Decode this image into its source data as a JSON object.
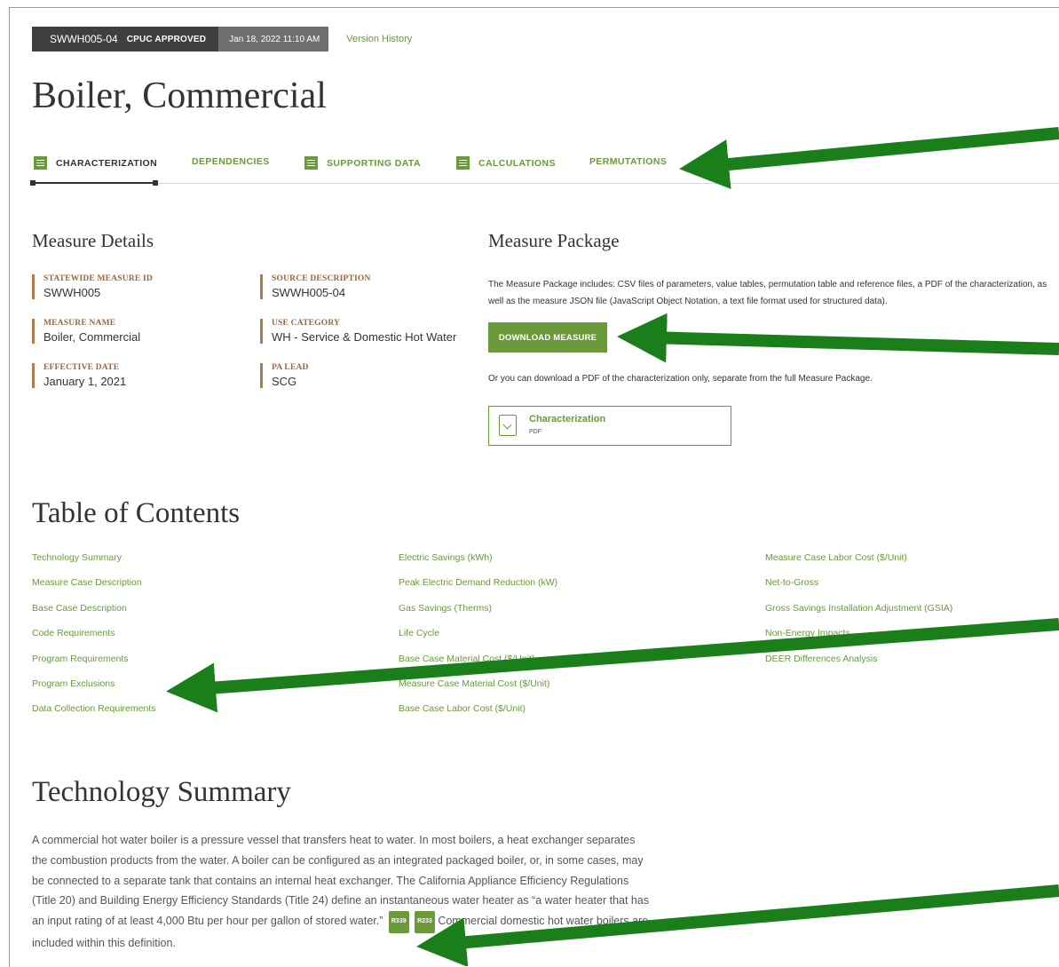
{
  "header": {
    "measure_code": "SWWH005-04",
    "status": "CPUC APPROVED",
    "timestamp": "Jan 18, 2022 11:10 AM",
    "version_history": "Version History"
  },
  "title": "Boiler, Commercial",
  "tabs": [
    {
      "label": "CHARACTERIZATION",
      "icon": "document-icon"
    },
    {
      "label": "DEPENDENCIES"
    },
    {
      "label": "SUPPORTING DATA",
      "icon": "document-icon"
    },
    {
      "label": "CALCULATIONS",
      "icon": "document-icon"
    },
    {
      "label": "PERMUTATIONS"
    }
  ],
  "measure_details": {
    "heading": "Measure Details",
    "fields": [
      {
        "label": "STATEWIDE MEASURE ID",
        "value": "SWWH005"
      },
      {
        "label": "SOURCE DESCRIPTION",
        "value": "SWWH005-04"
      },
      {
        "label": "MEASURE NAME",
        "value": "Boiler, Commercial"
      },
      {
        "label": "USE CATEGORY",
        "value": "WH - Service & Domestic Hot Water"
      },
      {
        "label": "EFFECTIVE DATE",
        "value": "January 1, 2021"
      },
      {
        "label": "PA LEAD",
        "value": "SCG"
      }
    ]
  },
  "measure_package": {
    "heading": "Measure Package",
    "description": "The Measure Package includes: CSV files of parameters, value tables, permutation table and reference files, a PDF of the characterization, as well as the measure JSON file (JavaScript Object Notation, a text file format used for structured data).",
    "download_label": "DOWNLOAD MEASURE",
    "alt_text": "Or you can download a PDF of the characterization only, separate from the full Measure Package.",
    "pdf_name": "Characterization",
    "pdf_type": "PDF"
  },
  "toc": {
    "heading": "Table of Contents",
    "col1": [
      "Technology Summary",
      "Measure Case Description",
      "Base Case Description",
      "Code Requirements",
      "Program Requirements",
      "Program Exclusions",
      "Data Collection Requirements"
    ],
    "col2": [
      "Electric Savings (kWh)",
      "Peak Electric Demand Reduction (kW)",
      "Gas Savings (Therms)",
      "Life Cycle",
      "Base Case Material Cost ($/Unit)",
      "Measure Case Material Cost ($/Unit)",
      "Base Case Labor Cost ($/Unit)"
    ],
    "col3": [
      "Measure Case Labor Cost ($/Unit)",
      "Net-to-Gross",
      "Gross Savings Installation Adjustment (GSIA)",
      "Non-Energy Impacts",
      "DEER Differences Analysis"
    ]
  },
  "summary": {
    "heading": "Technology Summary",
    "text_before": "A commercial hot water boiler is a pressure vessel that transfers heat to water. In most boilers, a heat exchanger separates the combustion products from the water. A boiler can be configured as an integrated packaged boiler, or, in some cases, may be connected to a separate tank that contains an internal heat exchanger. The California Appliance Efficiency Regulations (Title 20) and Building Energy Efficiency Standards (Title 24) define an instantaneous water heater as “a water heater that has an input rating of at least 4,000 Btu per hour per gallon of stored water.”",
    "ref1": "R339",
    "ref2": "R233",
    "text_after": "Commercial domestic hot water boilers are included within this definition."
  },
  "colors": {
    "accent": "#6a9a3a",
    "arrow": "#1a7f1a",
    "label_brown": "#a0653a"
  }
}
